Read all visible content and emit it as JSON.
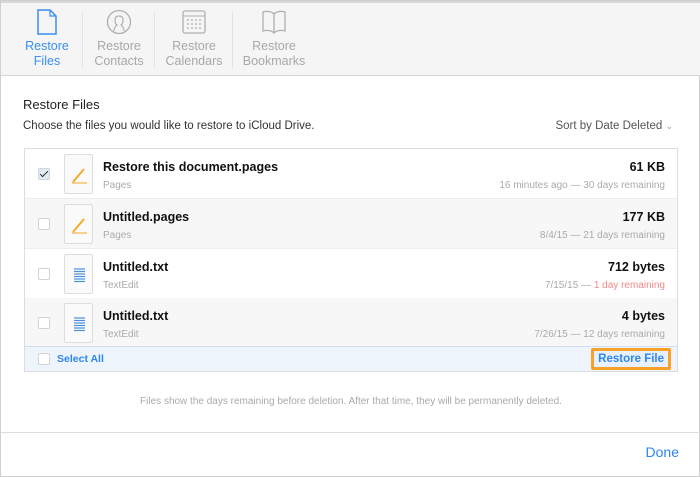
{
  "toolbar": {
    "tabs": [
      {
        "line1": "Restore",
        "line2": "Files",
        "icon": "file-icon",
        "active": true
      },
      {
        "line1": "Restore",
        "line2": "Contacts",
        "icon": "contact-icon"
      },
      {
        "line1": "Restore",
        "line2": "Calendars",
        "icon": "calendar-icon"
      },
      {
        "line1": "Restore",
        "line2": "Bookmarks",
        "icon": "book-icon"
      }
    ]
  },
  "main": {
    "title": "Restore Files",
    "subtitle": "Choose the files you would like to restore to iCloud Drive.",
    "sort": "Sort by Date Deleted"
  },
  "files": [
    {
      "name": "Restore this document.pages",
      "app": "Pages",
      "size": "61 KB",
      "date": "16 minutes ago",
      "remaining": "30 days remaining",
      "checked": true,
      "type": "pages"
    },
    {
      "name": "Untitled.pages",
      "app": "Pages",
      "size": "177 KB",
      "date": "8/4/15",
      "remaining": "21 days remaining",
      "checked": false,
      "type": "pages"
    },
    {
      "name": "Untitled.txt",
      "app": "TextEdit",
      "size": "712 bytes",
      "date": "7/15/15",
      "remaining": "1 day remaining",
      "checked": false,
      "type": "txt",
      "warning": true
    },
    {
      "name": "Untitled.txt",
      "app": "TextEdit",
      "size": "4 bytes",
      "date": "7/26/15",
      "remaining": "12 days remaining",
      "checked": false,
      "type": "txt"
    }
  ],
  "footer": {
    "select_all": "Select All",
    "restore": "Restore File"
  },
  "note": "Files show the days remaining before deletion. After that time, they will be permanently deleted.",
  "done": "Done",
  "colors": {
    "accent": "#2d86ee",
    "highlight": "#f7a128",
    "warning": "#f08a8a"
  }
}
